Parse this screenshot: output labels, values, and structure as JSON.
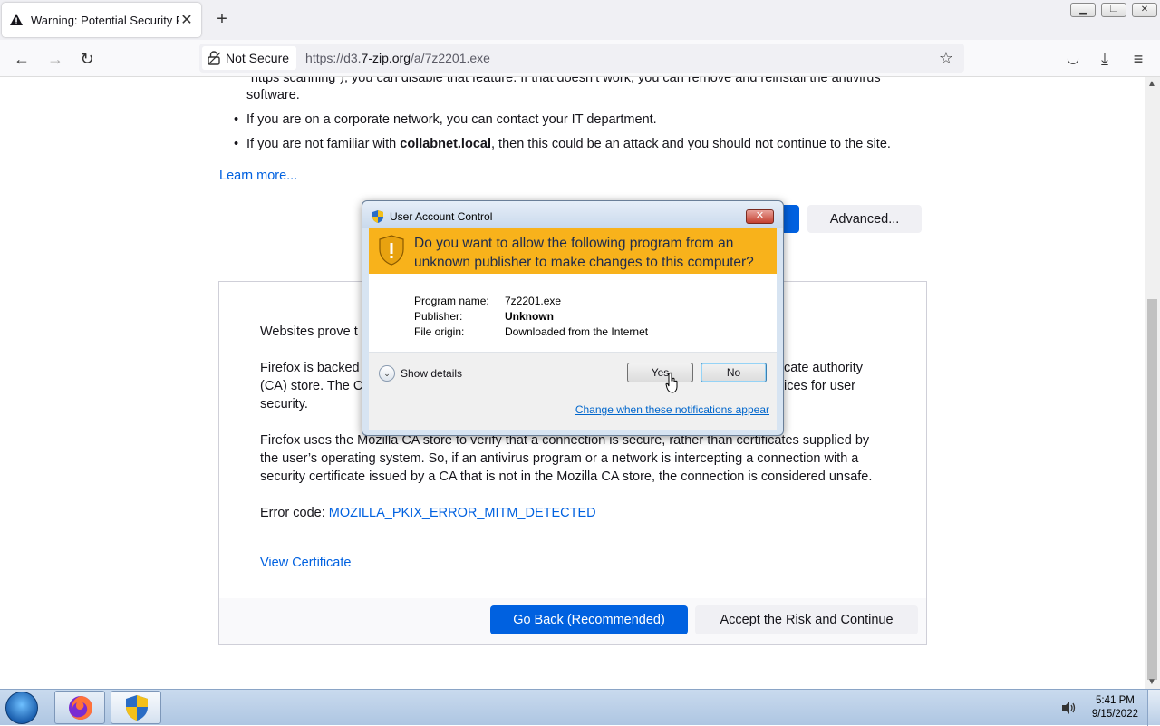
{
  "browser": {
    "tab_title": "Warning: Potential Security Risk",
    "new_tab": "+",
    "url_security_label": "Not Secure",
    "url_prefix": "https://d3.",
    "url_domain": "7-zip.org",
    "url_path": "/a/7z2201.exe"
  },
  "page": {
    "fragment_line1": "“https scanning”), you can disable that feature. If that doesn’t work, you can remove and reinstall the antivirus",
    "fragment_line2": "software.",
    "bullet1": "If you are on a corporate network, you can contact your IT department.",
    "bullet2_pre": "If you are not familiar with ",
    "bullet2_bold": "collabnet.local",
    "bullet2_post": ", then this could be an attack and you should not continue to the site.",
    "learn_more": "Learn more...",
    "advanced_button": "Advanced...",
    "advanced_para1": "Websites prove t",
    "advanced_para2_a": "Firefox is backed",
    "advanced_para2_b": "cate authority",
    "advanced_para2_c": "(CA) store. The C",
    "advanced_para2_d": "ices for user",
    "advanced_para2_e": "security.",
    "advanced_para3_l1": "Firefox uses the Mozilla CA store to verify that a connection is secure, rather than certificates supplied by",
    "advanced_para3_l2": "the user’s operating system. So, if an antivirus program or a network is intercepting a connection with a",
    "advanced_para3_l3": "security certificate issued by a CA that is not in the Mozilla CA store, the connection is considered unsafe.",
    "error_code_label": "Error code: ",
    "error_code": "MOZILLA_PKIX_ERROR_MITM_DETECTED",
    "view_certificate": "View Certificate",
    "go_back_button": "Go Back (Recommended)",
    "accept_button": "Accept the Risk and Continue"
  },
  "uac": {
    "title": "User Account Control",
    "close": "✕",
    "question": "Do you want to allow the following program from an unknown publisher to make changes to this computer?",
    "program_name_label": "Program name:",
    "program_name": "7z2201.exe",
    "publisher_label": "Publisher:",
    "publisher": "Unknown",
    "origin_label": "File origin:",
    "origin": "Downloaded from the Internet",
    "show_details": "Show details",
    "yes": "Yes",
    "no": "No",
    "change_link": "Change when these notifications appear"
  },
  "taskbar": {
    "time": "5:41 PM",
    "date": "9/15/2022"
  },
  "colors": {
    "accent_blue": "#0061e0",
    "uac_banner": "#f8b21b"
  }
}
